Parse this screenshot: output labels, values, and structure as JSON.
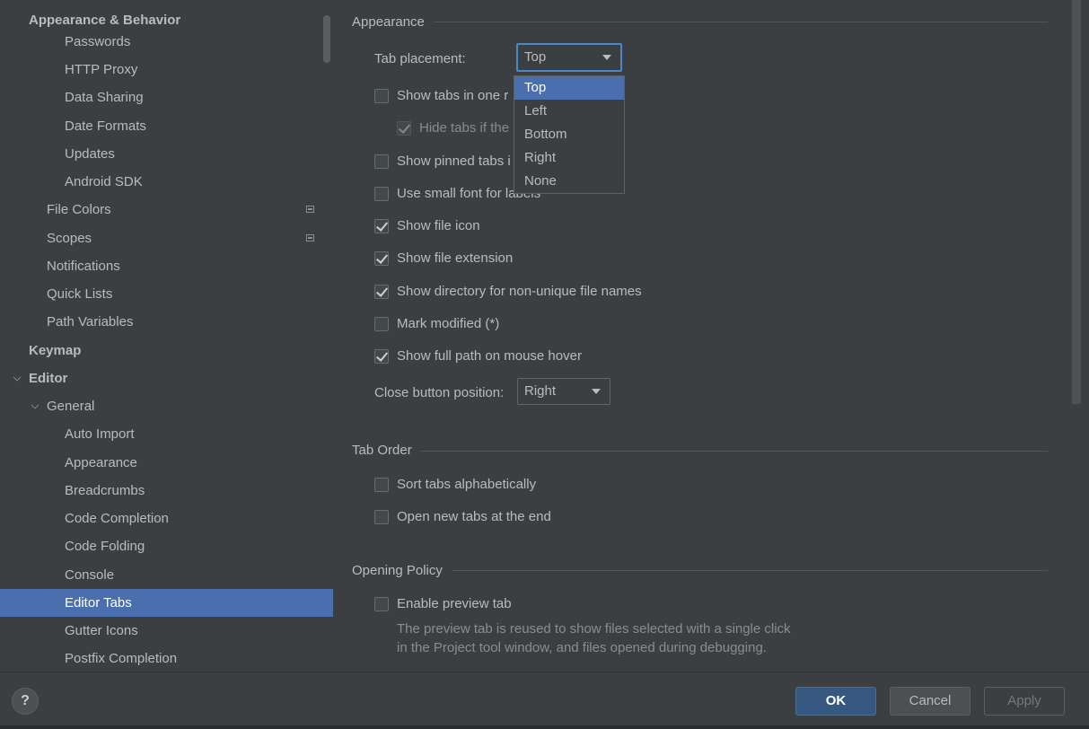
{
  "sidebar": {
    "items": [
      {
        "label": "Appearance & Behavior",
        "level": 0,
        "bold": true,
        "arrow": ""
      },
      {
        "label": "Passwords",
        "level": 2
      },
      {
        "label": "HTTP Proxy",
        "level": 2
      },
      {
        "label": "Data Sharing",
        "level": 2
      },
      {
        "label": "Date Formats",
        "level": 2
      },
      {
        "label": "Updates",
        "level": 2
      },
      {
        "label": "Android SDK",
        "level": 2
      },
      {
        "label": "File Colors",
        "level": 1,
        "icon": "project-scope-icon"
      },
      {
        "label": "Scopes",
        "level": 1,
        "icon": "project-scope-icon"
      },
      {
        "label": "Notifications",
        "level": 1
      },
      {
        "label": "Quick Lists",
        "level": 1
      },
      {
        "label": "Path Variables",
        "level": 1
      },
      {
        "label": "Keymap",
        "level": 0,
        "bold": true
      },
      {
        "label": "Editor",
        "level": 0,
        "bold": true,
        "arrow": "expanded"
      },
      {
        "label": "General",
        "level": 1,
        "arrow": "expanded"
      },
      {
        "label": "Auto Import",
        "level": 2
      },
      {
        "label": "Appearance",
        "level": 2
      },
      {
        "label": "Breadcrumbs",
        "level": 2
      },
      {
        "label": "Code Completion",
        "level": 2
      },
      {
        "label": "Code Folding",
        "level": 2
      },
      {
        "label": "Console",
        "level": 2
      },
      {
        "label": "Editor Tabs",
        "level": 2,
        "selected": true
      },
      {
        "label": "Gutter Icons",
        "level": 2
      },
      {
        "label": "Postfix Completion",
        "level": 2
      }
    ]
  },
  "appearance": {
    "title": "Appearance",
    "tab_placement_label": "Tab placement:",
    "tab_placement_value": "Top",
    "tab_placement_options": [
      "Top",
      "Left",
      "Bottom",
      "Right",
      "None"
    ],
    "tab_placement_selected_index": 0,
    "show_tabs_one_row": {
      "label": "Show tabs in one r",
      "checked": false
    },
    "hide_tabs": {
      "label": "Hide tabs if the",
      "checked": true,
      "disabled": true
    },
    "show_pinned": {
      "label": "Show pinned tabs i",
      "checked": false
    },
    "small_font": {
      "label": "Use small font for labels",
      "checked": false
    },
    "file_icon": {
      "label": "Show file icon",
      "checked": true
    },
    "file_extension": {
      "label": "Show file extension",
      "checked": true
    },
    "directory": {
      "label": "Show directory for non-unique file names",
      "checked": true
    },
    "mark_modified": {
      "label": "Mark modified (*)",
      "checked": false
    },
    "full_path": {
      "label": "Show full path on mouse hover",
      "checked": true
    },
    "close_button_label": "Close button position:",
    "close_button_value": "Right"
  },
  "tab_order": {
    "title": "Tab Order",
    "sort_alpha": {
      "label": "Sort tabs alphabetically",
      "checked": false
    },
    "open_end": {
      "label": "Open new tabs at the end",
      "checked": false
    }
  },
  "opening_policy": {
    "title": "Opening Policy",
    "preview_tab": {
      "label": "Enable preview tab",
      "checked": false
    },
    "description_line1": "The preview tab is reused to show files selected with a single click",
    "description_line2": "in the Project tool window, and files opened during debugging."
  },
  "footer": {
    "help_label": "?",
    "ok_label": "OK",
    "cancel_label": "Cancel",
    "apply_label": "Apply"
  }
}
